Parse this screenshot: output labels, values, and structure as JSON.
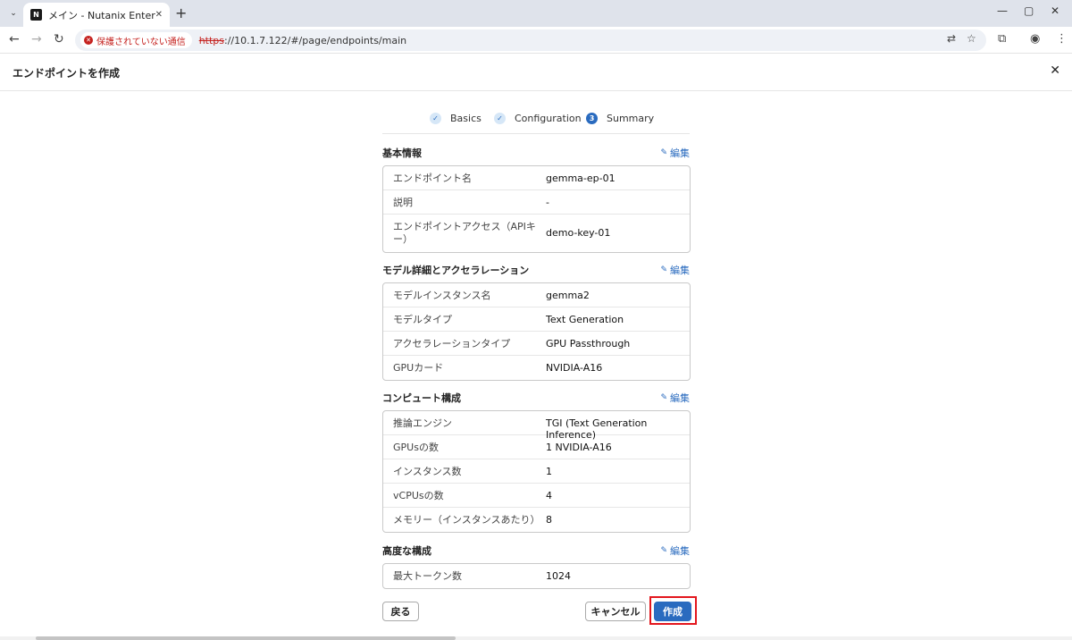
{
  "browser": {
    "tab_title": "メイン - Nutanix Enterprise AI",
    "favicon_text": "N",
    "security_label": "保護されていない通信",
    "url_scheme": "https",
    "url_rest": "://10.1.7.122/#/page/endpoints/main"
  },
  "page": {
    "title": "エンドポイントを作成"
  },
  "wizard": {
    "steps": [
      {
        "label": "Basics",
        "state": "done",
        "marker": "✓"
      },
      {
        "label": "Configuration",
        "state": "done",
        "marker": "✓"
      },
      {
        "label": "Summary",
        "state": "active",
        "marker": "3"
      }
    ]
  },
  "edit_label": "編集",
  "sections": {
    "basic": {
      "title": "基本情報",
      "rows": [
        {
          "label": "エンドポイント名",
          "value": "gemma-ep-01"
        },
        {
          "label": "説明",
          "value": "-"
        },
        {
          "label": "エンドポイントアクセス（APIキー）",
          "value": "demo-key-01"
        }
      ]
    },
    "model": {
      "title": "モデル詳細とアクセラレーション",
      "rows": [
        {
          "label": "モデルインスタンス名",
          "value": "gemma2"
        },
        {
          "label": "モデルタイプ",
          "value": "Text Generation"
        },
        {
          "label": "アクセラレーションタイプ",
          "value": "GPU Passthrough"
        },
        {
          "label": "GPUカード",
          "value": "NVIDIA-A16"
        }
      ]
    },
    "compute": {
      "title": "コンピュート構成",
      "rows": [
        {
          "label": "推論エンジン",
          "value": "TGI (Text Generation Inference)"
        },
        {
          "label": "GPUsの数",
          "value": "1 NVIDIA-A16"
        },
        {
          "label": "インスタンス数",
          "value": "1"
        },
        {
          "label": "vCPUsの数",
          "value": "4"
        },
        {
          "label": "メモリー（インスタンスあたり）",
          "value": "8"
        }
      ]
    },
    "advanced": {
      "title": "高度な構成",
      "rows": [
        {
          "label": "最大トークン数",
          "value": "1024"
        }
      ]
    }
  },
  "buttons": {
    "back": "戻る",
    "cancel": "キャンセル",
    "create": "作成"
  }
}
